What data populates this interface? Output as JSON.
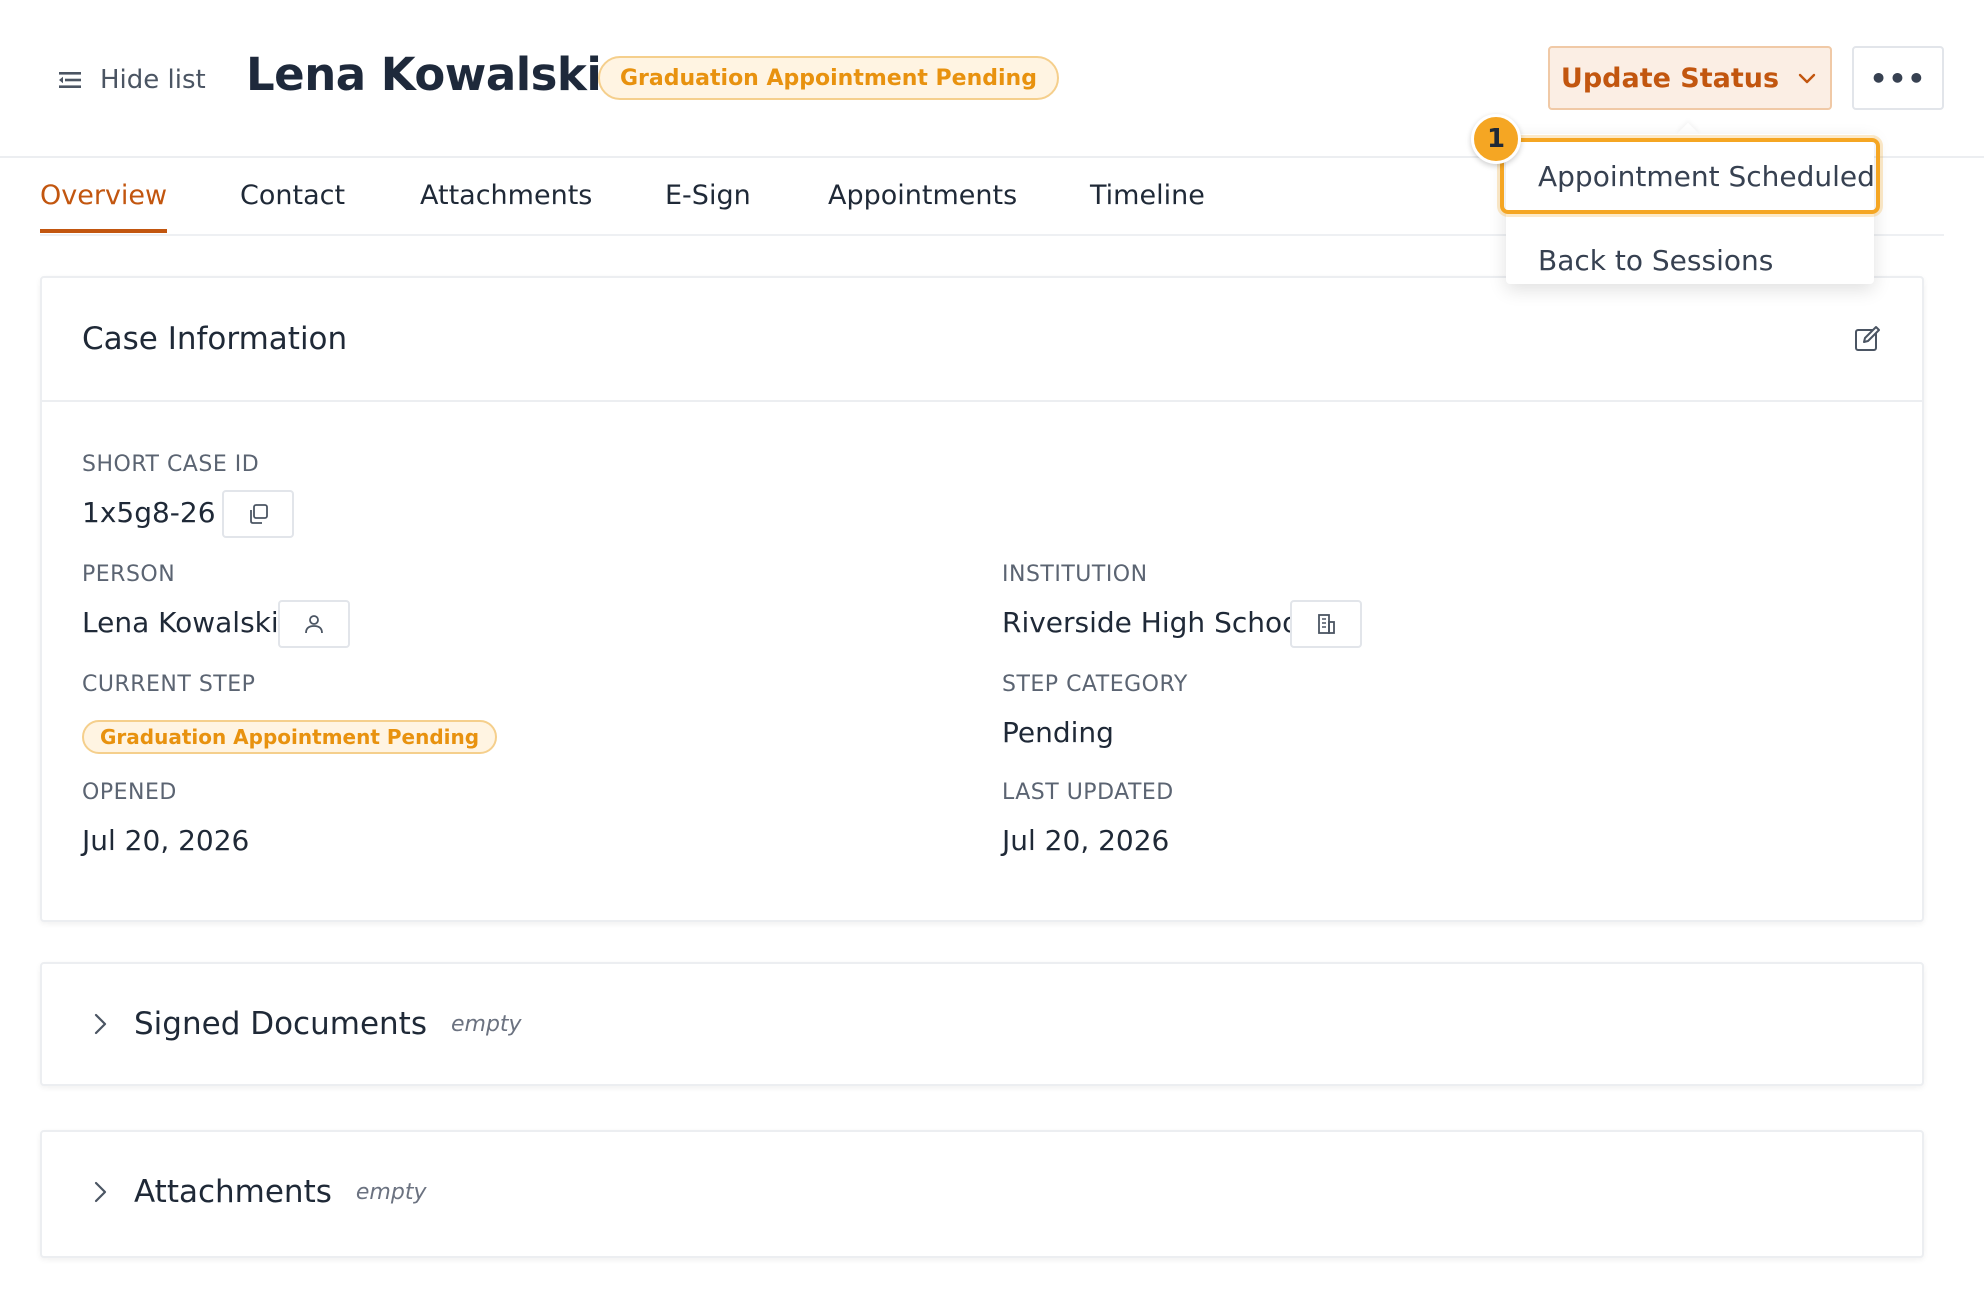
{
  "header": {
    "hide_list_label": "Hide list",
    "person_name": "Lena Kowalski",
    "status_badge": "Graduation Appointment Pending",
    "update_status_label": "Update Status",
    "more_label": "•••"
  },
  "tabs": [
    {
      "label": "Overview",
      "active": true
    },
    {
      "label": "Contact"
    },
    {
      "label": "Attachments"
    },
    {
      "label": "E-Sign"
    },
    {
      "label": "Appointments"
    },
    {
      "label": "Timeline"
    }
  ],
  "dropdown": {
    "items": [
      {
        "label": "Appointment Scheduled",
        "highlighted": true
      },
      {
        "label": "Back to Sessions"
      }
    ],
    "marker": "1"
  },
  "case_info": {
    "title": "Case Information",
    "short_case_id_label": "SHORT CASE ID",
    "short_case_id": "1x5g8-26",
    "person_label": "PERSON",
    "person": "Lena Kowalski",
    "institution_label": "INSTITUTION",
    "institution": "Riverside High School",
    "current_step_label": "CURRENT STEP",
    "current_step": "Graduation Appointment Pending",
    "step_category_label": "STEP CATEGORY",
    "step_category": "Pending",
    "opened_label": "OPENED",
    "opened": "Jul 20, 2026",
    "last_updated_label": "LAST UPDATED",
    "last_updated": "Jul 20, 2026"
  },
  "sections": {
    "signed_documents": {
      "title": "Signed Documents",
      "status": "empty"
    },
    "attachments": {
      "title": "Attachments",
      "status": "empty"
    }
  },
  "colors": {
    "accent": "#c2560f",
    "badge_text": "#e8920f",
    "badge_bg": "#fff4e2",
    "highlight": "#f5a623"
  }
}
